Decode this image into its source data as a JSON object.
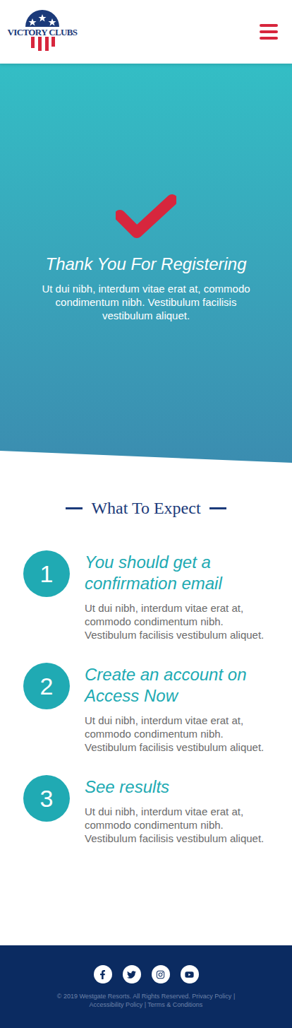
{
  "header": {
    "logo": "VICTORY CLUBS"
  },
  "hero": {
    "title": "Thank You For Registering",
    "text": "Ut dui nibh, interdum vitae erat at, commodo condimentum nibh. Vestibulum facilisis vestibulum aliquet."
  },
  "section": {
    "heading": "What To Expect"
  },
  "steps": [
    {
      "number": "1",
      "title": "You should get a confirmation email",
      "text": "Ut dui nibh, interdum vitae erat at, commodo condimentum nibh. Vestibulum facilisis vestibulum aliquet."
    },
    {
      "number": "2",
      "title": "Create an account on Access Now",
      "text": "Ut dui nibh, interdum vitae erat at, commodo condimentum nibh. Vestibulum facilisis vestibulum aliquet."
    },
    {
      "number": "3",
      "title": "See results",
      "text": "Ut dui nibh, interdum vitae erat at, commodo condimentum nibh. Vestibulum facilisis vestibulum aliquet."
    }
  ],
  "footer": {
    "copyright": "© 2019 Westgate Resorts. All Rights Reserved.",
    "separator": "|",
    "links": [
      "Privacy Policy",
      "Accessibility Policy",
      "Terms & Conditions"
    ]
  }
}
